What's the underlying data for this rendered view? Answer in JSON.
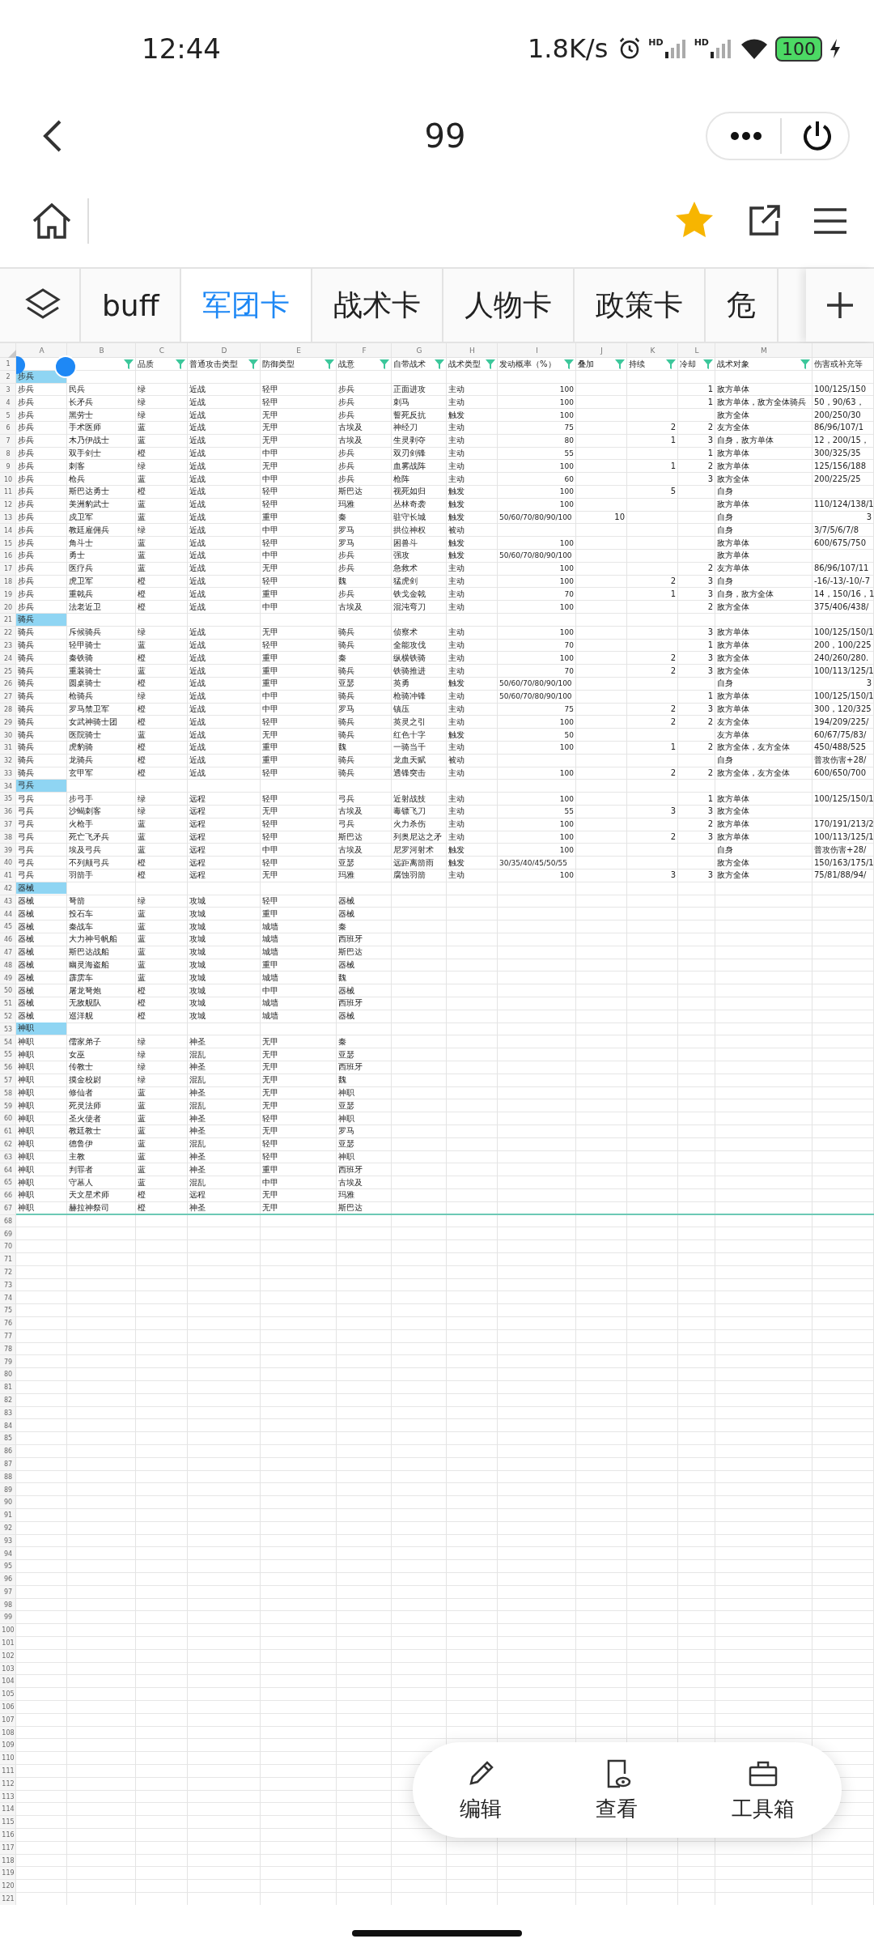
{
  "status_bar": {
    "time": "12:44",
    "speed": "1.8K/s",
    "sim_labels": [
      "HD",
      "HD"
    ],
    "battery": "100"
  },
  "header": {
    "title": "99"
  },
  "tabs": [
    {
      "label": "buff",
      "selected": false
    },
    {
      "label": "军团卡",
      "selected": true
    },
    {
      "label": "战术卡",
      "selected": false
    },
    {
      "label": "人物卡",
      "selected": false
    },
    {
      "label": "政策卡",
      "selected": false
    },
    {
      "label": "危",
      "selected": false
    }
  ],
  "sheet": {
    "columns": [
      {
        "letter": "A"
      },
      {
        "letter": "B",
        "filter": true
      },
      {
        "letter": "C",
        "header": "品质",
        "filter": true
      },
      {
        "letter": "D",
        "header": "普通攻击类型",
        "filter": true
      },
      {
        "letter": "E",
        "header": "防御类型",
        "filter": true
      },
      {
        "letter": "F",
        "header": "战意",
        "filter": true
      },
      {
        "letter": "G",
        "header": "自带战术",
        "filter": true
      },
      {
        "letter": "H",
        "header": "战术类型",
        "filter": true
      },
      {
        "letter": "I",
        "header": "发动概率（%）",
        "filter": true
      },
      {
        "letter": "J",
        "header": "叠加",
        "filter": true
      },
      {
        "letter": "K",
        "header": "持续",
        "filter": true
      },
      {
        "letter": "L",
        "header": "冷却",
        "filter": true
      },
      {
        "letter": "M",
        "header": "战术对象",
        "filter": true
      },
      {
        "header": "伤害或补充等"
      }
    ],
    "header_row": "1",
    "rows": [
      {
        "n": "2",
        "kind": "group",
        "label": "步兵"
      },
      {
        "n": "3",
        "kind": "unit",
        "cells": [
          "步兵",
          "民兵",
          "绿",
          "近战",
          "轻甲",
          "步兵",
          "正面进攻",
          "主动",
          "100",
          null,
          null,
          "1",
          "敌方单体",
          "100/125/150"
        ]
      },
      {
        "n": "4",
        "kind": "unit",
        "cells": [
          "步兵",
          "长矛兵",
          "绿",
          "近战",
          "轻甲",
          "步兵",
          "刺马",
          "主动",
          "100",
          null,
          null,
          "1",
          "敌方单体，敌方全体骑兵",
          "50，90/63，"
        ]
      },
      {
        "n": "5",
        "kind": "unit",
        "cells": [
          "步兵",
          "黑劳士",
          "绿",
          "近战",
          "无甲",
          "步兵",
          "誓死反抗",
          "触发",
          "100",
          null,
          null,
          null,
          "敌方全体",
          "200/250/30"
        ]
      },
      {
        "n": "6",
        "kind": "unit",
        "cells": [
          "步兵",
          "手术医师",
          "蓝",
          "近战",
          "无甲",
          "古埃及",
          "神经刀",
          "主动",
          "75",
          null,
          "2",
          "2",
          "友方全体",
          "86/96/107/1"
        ]
      },
      {
        "n": "7",
        "kind": "unit",
        "cells": [
          "步兵",
          "木乃伊战士",
          "蓝",
          "近战",
          "无甲",
          "古埃及",
          "生灵剥夺",
          "主动",
          "80",
          null,
          "1",
          "3",
          "自身，敌方单体",
          "12，200/15，"
        ]
      },
      {
        "n": "8",
        "kind": "unit",
        "cells": [
          "步兵",
          "双手剑士",
          "橙",
          "近战",
          "中甲",
          "步兵",
          "双刃剑锋",
          "主动",
          "55",
          null,
          null,
          "1",
          "敌方单体",
          "300/325/35"
        ]
      },
      {
        "n": "9",
        "kind": "unit",
        "cells": [
          "步兵",
          "刺客",
          "绿",
          "近战",
          "无甲",
          "步兵",
          "血雾战阵",
          "主动",
          "100",
          null,
          "1",
          "2",
          "敌方单体",
          "125/156/188"
        ]
      },
      {
        "n": "10",
        "kind": "unit",
        "cells": [
          "步兵",
          "枪兵",
          "蓝",
          "近战",
          "中甲",
          "步兵",
          "枪阵",
          "主动",
          "60",
          null,
          null,
          "3",
          "敌方全体",
          "200/225/25"
        ]
      },
      {
        "n": "11",
        "kind": "unit",
        "cells": [
          "步兵",
          "斯巴达勇士",
          "橙",
          "近战",
          "轻甲",
          "斯巴达",
          "视死如归",
          "触发",
          "100",
          null,
          "5",
          null,
          "自身",
          null
        ]
      },
      {
        "n": "12",
        "kind": "unit",
        "cells": [
          "步兵",
          "美洲豹武士",
          "蓝",
          "近战",
          "轻甲",
          "玛雅",
          "丛林奇袭",
          "触发",
          "100",
          null,
          null,
          null,
          "敌方单体",
          "110/124/138/1"
        ]
      },
      {
        "n": "13",
        "kind": "unit",
        "cells": [
          "步兵",
          "戍卫军",
          "蓝",
          "近战",
          "重甲",
          "秦",
          "驻守长城",
          "触发",
          "50/60/70/80/90/100",
          "10",
          null,
          null,
          "自身",
          "3"
        ]
      },
      {
        "n": "14",
        "kind": "unit",
        "cells": [
          "步兵",
          "教廷雇佣兵",
          "绿",
          "近战",
          "中甲",
          "罗马",
          "拱位神权",
          "被动",
          null,
          null,
          null,
          null,
          "自身",
          "3/7/5/6/7/8"
        ]
      },
      {
        "n": "15",
        "kind": "unit",
        "cells": [
          "步兵",
          "角斗士",
          "蓝",
          "近战",
          "轻甲",
          "罗马",
          "困兽斗",
          "触发",
          "100",
          null,
          null,
          null,
          "敌方单体",
          "600/675/750"
        ]
      },
      {
        "n": "16",
        "kind": "unit",
        "cells": [
          "步兵",
          "勇士",
          "蓝",
          "近战",
          "中甲",
          "步兵",
          "强攻",
          "触发",
          "50/60/70/80/90/100",
          null,
          null,
          null,
          "敌方单体",
          null
        ]
      },
      {
        "n": "17",
        "kind": "unit",
        "cells": [
          "步兵",
          "医疗兵",
          "蓝",
          "近战",
          "无甲",
          "步兵",
          "急救术",
          "主动",
          "100",
          null,
          null,
          "2",
          "友方单体",
          "86/96/107/11"
        ]
      },
      {
        "n": "18",
        "kind": "unit",
        "cells": [
          "步兵",
          "虎卫军",
          "橙",
          "近战",
          "轻甲",
          "魏",
          "猛虎剑",
          "主动",
          "100",
          null,
          "2",
          "3",
          "自身",
          "-16/-13/-10/-7"
        ]
      },
      {
        "n": "19",
        "kind": "unit",
        "cells": [
          "步兵",
          "重戟兵",
          "橙",
          "近战",
          "重甲",
          "步兵",
          "铁戈金戟",
          "主动",
          "70",
          null,
          "1",
          "3",
          "自身，敌方全体",
          "14，150/16，1"
        ]
      },
      {
        "n": "20",
        "kind": "unit",
        "cells": [
          "步兵",
          "法老近卫",
          "橙",
          "近战",
          "中甲",
          "古埃及",
          "混沌弯刀",
          "主动",
          "100",
          null,
          null,
          "2",
          "敌方全体",
          "375/406/438/"
        ]
      },
      {
        "n": "21",
        "kind": "group",
        "label": "骑兵"
      },
      {
        "n": "22",
        "kind": "unit",
        "cells": [
          "骑兵",
          "斥候骑兵",
          "绿",
          "近战",
          "无甲",
          "骑兵",
          "侦察术",
          "主动",
          "100",
          null,
          null,
          "3",
          "敌方单体",
          "100/125/150/1"
        ]
      },
      {
        "n": "23",
        "kind": "unit",
        "cells": [
          "骑兵",
          "轻甲骑士",
          "蓝",
          "近战",
          "轻甲",
          "骑兵",
          "全能攻伐",
          "主动",
          "70",
          null,
          null,
          "1",
          "敌方单体",
          "200，100/225"
        ]
      },
      {
        "n": "24",
        "kind": "unit",
        "cells": [
          "骑兵",
          "秦铁骑",
          "橙",
          "近战",
          "重甲",
          "秦",
          "纵横铁骑",
          "主动",
          "100",
          null,
          "2",
          "3",
          "敌方全体",
          "240/260/280."
        ]
      },
      {
        "n": "25",
        "kind": "unit",
        "cells": [
          "骑兵",
          "重装骑士",
          "蓝",
          "近战",
          "重甲",
          "骑兵",
          "铁骑推进",
          "主动",
          "70",
          null,
          "2",
          "3",
          "敌方全体",
          "100/113/125/1"
        ]
      },
      {
        "n": "26",
        "kind": "unit",
        "cells": [
          "骑兵",
          "圆桌骑士",
          "橙",
          "近战",
          "重甲",
          "亚瑟",
          "英勇",
          "触发",
          "50/60/70/80/90/100",
          null,
          null,
          null,
          "自身",
          "3"
        ]
      },
      {
        "n": "27",
        "kind": "unit",
        "cells": [
          "骑兵",
          "枪骑兵",
          "绿",
          "近战",
          "中甲",
          "骑兵",
          "枪骑冲锋",
          "主动",
          "50/60/70/80/90/100",
          null,
          null,
          "1",
          "敌方单体",
          "100/125/150/1"
        ]
      },
      {
        "n": "28",
        "kind": "unit",
        "cells": [
          "骑兵",
          "罗马禁卫军",
          "橙",
          "近战",
          "中甲",
          "罗马",
          "镇压",
          "主动",
          "75",
          null,
          "2",
          "3",
          "敌方单体",
          "300，120/325"
        ]
      },
      {
        "n": "29",
        "kind": "unit",
        "cells": [
          "骑兵",
          "女武神骑士团",
          "橙",
          "近战",
          "轻甲",
          "骑兵",
          "英灵之引",
          "主动",
          "100",
          null,
          "2",
          "2",
          "友方全体",
          "194/209/225/"
        ]
      },
      {
        "n": "30",
        "kind": "unit",
        "cells": [
          "骑兵",
          "医院骑士",
          "蓝",
          "近战",
          "无甲",
          "骑兵",
          "红色十字",
          "触发",
          "50",
          null,
          null,
          null,
          "友方单体",
          "60/67/75/83/"
        ]
      },
      {
        "n": "31",
        "kind": "unit",
        "cells": [
          "骑兵",
          "虎豹骑",
          "橙",
          "近战",
          "重甲",
          "魏",
          "一骑当千",
          "主动",
          "100",
          null,
          "1",
          "2",
          "敌方全体，友方全体",
          "450/488/525"
        ]
      },
      {
        "n": "32",
        "kind": "unit",
        "cells": [
          "骑兵",
          "龙骑兵",
          "橙",
          "近战",
          "重甲",
          "骑兵",
          "龙血天赋",
          "被动",
          null,
          null,
          null,
          null,
          "自身",
          "普攻伤害+28/"
        ]
      },
      {
        "n": "33",
        "kind": "unit",
        "cells": [
          "骑兵",
          "玄甲军",
          "橙",
          "近战",
          "轻甲",
          "骑兵",
          "透锋突击",
          "主动",
          "100",
          null,
          "2",
          "2",
          "敌方全体，友方全体",
          "600/650/700"
        ]
      },
      {
        "n": "34",
        "kind": "group",
        "label": "弓兵"
      },
      {
        "n": "35",
        "kind": "unit",
        "cells": [
          "弓兵",
          "步弓手",
          "绿",
          "远程",
          "轻甲",
          "弓兵",
          "近射战技",
          "主动",
          "100",
          null,
          null,
          "1",
          "敌方单体",
          "100/125/150/1"
        ]
      },
      {
        "n": "36",
        "kind": "unit",
        "cells": [
          "弓兵",
          "沙蝎刺客",
          "绿",
          "远程",
          "无甲",
          "古埃及",
          "毒镖飞刀",
          "主动",
          "55",
          null,
          "3",
          "3",
          "敌方全体",
          null
        ]
      },
      {
        "n": "37",
        "kind": "unit",
        "cells": [
          "弓兵",
          "火枪手",
          "蓝",
          "远程",
          "轻甲",
          "弓兵",
          "火力杀伤",
          "主动",
          "100",
          null,
          null,
          "2",
          "敌方单体",
          "170/191/213/2"
        ]
      },
      {
        "n": "38",
        "kind": "unit",
        "cells": [
          "弓兵",
          "死亡飞矛兵",
          "蓝",
          "远程",
          "轻甲",
          "斯巴达",
          "列奥尼达之矛",
          "主动",
          "100",
          null,
          "2",
          "3",
          "敌方单体",
          "100/113/125/1"
        ]
      },
      {
        "n": "39",
        "kind": "unit",
        "cells": [
          "弓兵",
          "埃及弓兵",
          "蓝",
          "远程",
          "中甲",
          "古埃及",
          "尼罗河射术",
          "触发",
          "100",
          null,
          null,
          null,
          "自身",
          "普攻伤害+28/"
        ]
      },
      {
        "n": "40",
        "kind": "unit",
        "cells": [
          "弓兵",
          "不列颠弓兵",
          "橙",
          "远程",
          "轻甲",
          "亚瑟",
          "远距离箭雨",
          "触发",
          "30/35/40/45/50/55",
          null,
          null,
          null,
          "敌方全体",
          "150/163/175/1"
        ]
      },
      {
        "n": "41",
        "kind": "unit",
        "cells": [
          "弓兵",
          "羽箭手",
          "橙",
          "远程",
          "无甲",
          "玛雅",
          "腐蚀羽箭",
          "主动",
          "100",
          null,
          "3",
          "3",
          "敌方全体",
          "75/81/88/94/"
        ]
      },
      {
        "n": "42",
        "kind": "group",
        "label": "器械"
      },
      {
        "n": "43",
        "kind": "unit",
        "cells": [
          "器械",
          "弩箭",
          "绿",
          "攻城",
          "轻甲",
          "器械"
        ]
      },
      {
        "n": "44",
        "kind": "unit",
        "cells": [
          "器械",
          "投石车",
          "蓝",
          "攻城",
          "重甲",
          "器械"
        ]
      },
      {
        "n": "45",
        "kind": "unit",
        "cells": [
          "器械",
          "秦战车",
          "蓝",
          "攻城",
          "城墙",
          "秦"
        ]
      },
      {
        "n": "46",
        "kind": "unit",
        "cells": [
          "器械",
          "大力神号帆船",
          "蓝",
          "攻城",
          "城墙",
          "西班牙"
        ]
      },
      {
        "n": "47",
        "kind": "unit",
        "cells": [
          "器械",
          "斯巴达战船",
          "蓝",
          "攻城",
          "城墙",
          "斯巴达"
        ]
      },
      {
        "n": "48",
        "kind": "unit",
        "cells": [
          "器械",
          "幽灵海盗船",
          "蓝",
          "攻城",
          "重甲",
          "器械"
        ]
      },
      {
        "n": "49",
        "kind": "unit",
        "cells": [
          "器械",
          "霹雳车",
          "蓝",
          "攻城",
          "城墙",
          "魏"
        ]
      },
      {
        "n": "50",
        "kind": "unit",
        "cells": [
          "器械",
          "屠龙弩炮",
          "橙",
          "攻城",
          "中甲",
          "器械"
        ]
      },
      {
        "n": "51",
        "kind": "unit",
        "cells": [
          "器械",
          "无敌舰队",
          "橙",
          "攻城",
          "城墙",
          "西班牙"
        ]
      },
      {
        "n": "52",
        "kind": "unit",
        "cells": [
          "器械",
          "巡洋舰",
          "橙",
          "攻城",
          "城墙",
          "器械"
        ]
      },
      {
        "n": "53",
        "kind": "group",
        "label": "神职"
      },
      {
        "n": "54",
        "kind": "unit",
        "cells": [
          "神职",
          "儒家弟子",
          "绿",
          "神圣",
          "无甲",
          "秦"
        ]
      },
      {
        "n": "55",
        "kind": "unit",
        "cells": [
          "神职",
          "女巫",
          "绿",
          "混乱",
          "无甲",
          "亚瑟"
        ]
      },
      {
        "n": "56",
        "kind": "unit",
        "cells": [
          "神职",
          "传教士",
          "绿",
          "神圣",
          "无甲",
          "西班牙"
        ]
      },
      {
        "n": "57",
        "kind": "unit",
        "cells": [
          "神职",
          "摸金校尉",
          "绿",
          "混乱",
          "无甲",
          "魏"
        ]
      },
      {
        "n": "58",
        "kind": "unit",
        "cells": [
          "神职",
          "修仙者",
          "蓝",
          "神圣",
          "无甲",
          "神职"
        ]
      },
      {
        "n": "59",
        "kind": "unit",
        "cells": [
          "神职",
          "死灵法师",
          "蓝",
          "混乱",
          "无甲",
          "亚瑟"
        ]
      },
      {
        "n": "60",
        "kind": "unit",
        "cells": [
          "神职",
          "圣火使者",
          "蓝",
          "神圣",
          "轻甲",
          "神职"
        ]
      },
      {
        "n": "61",
        "kind": "unit",
        "cells": [
          "神职",
          "教廷教士",
          "蓝",
          "神圣",
          "无甲",
          "罗马"
        ]
      },
      {
        "n": "62",
        "kind": "unit",
        "cells": [
          "神职",
          "德鲁伊",
          "蓝",
          "混乱",
          "轻甲",
          "亚瑟"
        ]
      },
      {
        "n": "63",
        "kind": "unit",
        "cells": [
          "神职",
          "主教",
          "蓝",
          "神圣",
          "轻甲",
          "神职"
        ]
      },
      {
        "n": "64",
        "kind": "unit",
        "cells": [
          "神职",
          "判罪者",
          "蓝",
          "神圣",
          "重甲",
          "西班牙"
        ]
      },
      {
        "n": "65",
        "kind": "unit",
        "cells": [
          "神职",
          "守墓人",
          "蓝",
          "混乱",
          "中甲",
          "古埃及"
        ]
      },
      {
        "n": "66",
        "kind": "unit",
        "cells": [
          "神职",
          "天文星术师",
          "橙",
          "远程",
          "无甲",
          "玛雅"
        ]
      },
      {
        "n": "67",
        "kind": "unit",
        "cells": [
          "神职",
          "赫拉神祭司",
          "橙",
          "神圣",
          "无甲",
          "斯巴达"
        ]
      }
    ],
    "blank_rows": [
      "68",
      "69",
      "70",
      "71",
      "72",
      "73",
      "74",
      "75",
      "76",
      "77",
      "78",
      "79",
      "80",
      "81",
      "82",
      "83",
      "84",
      "85",
      "86",
      "87",
      "88",
      "89",
      "90",
      "91",
      "92",
      "93",
      "94",
      "95",
      "96",
      "97",
      "98",
      "99",
      "100",
      "101",
      "102",
      "103",
      "104",
      "105",
      "106",
      "107",
      "108",
      "109",
      "110",
      "111",
      "112",
      "113",
      "114",
      "115",
      "116",
      "117",
      "118",
      "119",
      "120",
      "121"
    ]
  },
  "toolbar": [
    {
      "kind": "edit",
      "label": "编辑"
    },
    {
      "kind": "view",
      "label": "查看"
    },
    {
      "kind": "tools",
      "label": "工具箱"
    }
  ]
}
